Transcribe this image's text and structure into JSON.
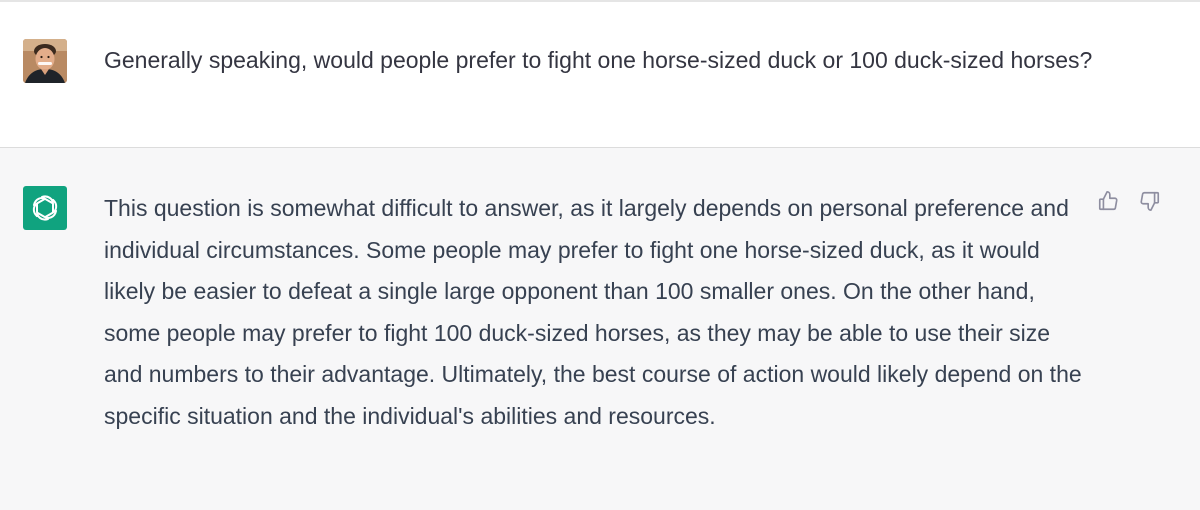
{
  "colors": {
    "assistant_brand": "#10a37f",
    "assistant_background": "#f7f7f8",
    "user_background": "#ffffff",
    "text": "#374151"
  },
  "user_message": {
    "avatar_icon": "user-avatar-photo",
    "text": "Generally speaking, would people prefer to fight one horse-sized duck or 100 duck-sized horses?"
  },
  "assistant_message": {
    "avatar_icon": "chatgpt-logo-icon",
    "text": "This question is somewhat difficult to answer, as it largely depends on personal preference and individual circumstances. Some people may prefer to fight one horse-sized duck, as it would likely be easier to defeat a single large opponent than 100 smaller ones. On the other hand, some people may prefer to fight 100 duck-sized horses, as they may be able to use their size and numbers to their advantage. Ultimately, the best course of action would likely depend on the specific situation and the individual's abilities and resources.",
    "feedback_icons": [
      "thumbs-up-icon",
      "thumbs-down-icon"
    ]
  }
}
